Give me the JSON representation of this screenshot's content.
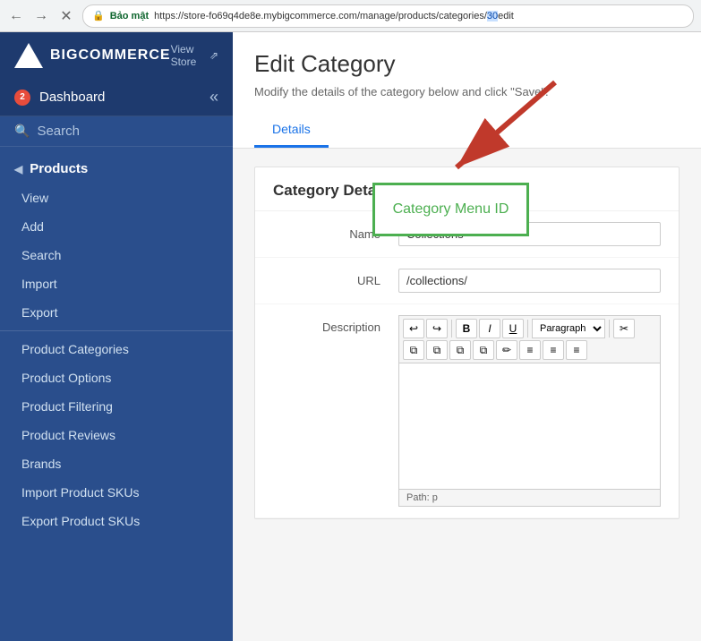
{
  "browser": {
    "back_label": "←",
    "forward_label": "→",
    "close_label": "✕",
    "secure_label": "Bảo mật",
    "url_prefix": "https://",
    "url_host": "store-fo69q4de8e.mybigcommerce.com",
    "url_path": "/manage/products/categories/",
    "url_id": "30",
    "url_suffix": "edit"
  },
  "sidebar": {
    "logo_text": "BIGCOMMERCE",
    "view_store_label": "View Store",
    "view_store_icon": "↗",
    "dashboard_label": "Dashboard",
    "dashboard_badge": "2",
    "collapse_icon": "«",
    "search_label": "Search",
    "products_section": "Products",
    "products_collapse": "◀",
    "nav_items": [
      {
        "label": "View"
      },
      {
        "label": "Add"
      },
      {
        "label": "Search"
      },
      {
        "label": "Import"
      },
      {
        "label": "Export"
      }
    ],
    "extra_items": [
      {
        "label": "Product Categories"
      },
      {
        "label": "Product Options"
      },
      {
        "label": "Product Filtering"
      },
      {
        "label": "Product Reviews"
      },
      {
        "label": "Brands"
      },
      {
        "label": "Import Product SKUs"
      },
      {
        "label": "Export Product SKUs"
      }
    ]
  },
  "page": {
    "title": "Edit Category",
    "subtitle": "Modify the details of the category below and click \"Save\".",
    "tab_details": "Details"
  },
  "form": {
    "section_title": "Category Details",
    "name_label": "Name",
    "name_value": "Collections",
    "url_label": "URL",
    "url_value": "/collections/",
    "description_label": "Description",
    "editor_path": "Path: p",
    "paragraph_option": "Paragraph",
    "toolbar_buttons": [
      "↩",
      "↪",
      "B",
      "I",
      "U"
    ],
    "toolbar_row2": [
      "✂",
      "⧉",
      "⧉",
      "⧉",
      "⧉",
      "✎",
      "≡",
      "≡",
      "≡"
    ]
  },
  "annotation": {
    "category_menu_id_label": "Category Menu ID"
  }
}
